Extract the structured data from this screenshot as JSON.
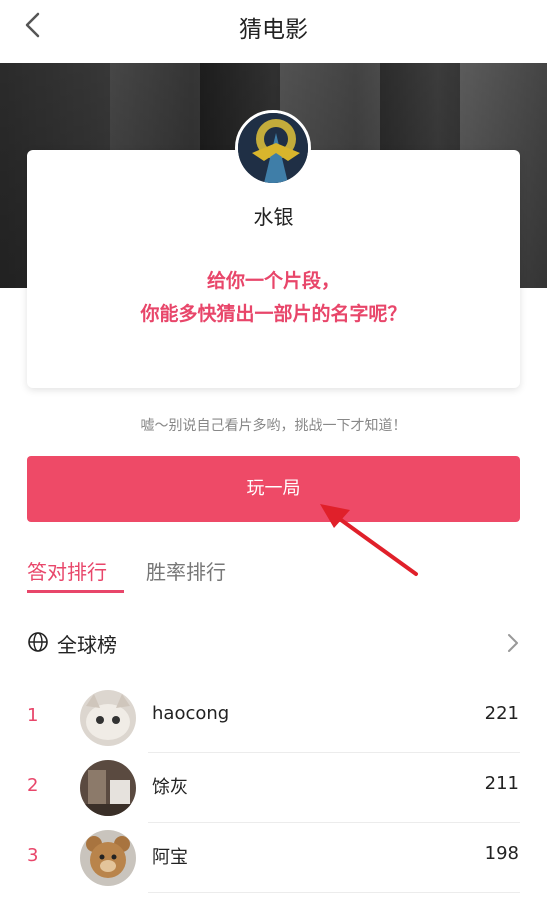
{
  "header": {
    "title": "猜电影"
  },
  "profile": {
    "name": "水银"
  },
  "card": {
    "line1": "给你一个片段，",
    "line2": "你能多快猜出一部片的名字呢？"
  },
  "hint": "嘘～别说自己看片多哟，挑战一下才知道！",
  "play_button": "玩一局",
  "tabs": [
    {
      "label": "答对排行",
      "active": true
    },
    {
      "label": "胜率排行",
      "active": false
    }
  ],
  "board": {
    "title": "全球榜"
  },
  "ranking": [
    {
      "rank": "1",
      "name": "haocong",
      "score": "221"
    },
    {
      "rank": "2",
      "name": "馀灰",
      "score": "211"
    },
    {
      "rank": "3",
      "name": "阿宝",
      "score": "198"
    }
  ],
  "colors": {
    "accent": "#ee4a67",
    "accent_text": "#e8466a",
    "annotation_arrow": "#e0202a"
  },
  "icons": {
    "back": "chevron-left-icon",
    "globe": "globe-icon",
    "more": "chevron-right-icon"
  }
}
